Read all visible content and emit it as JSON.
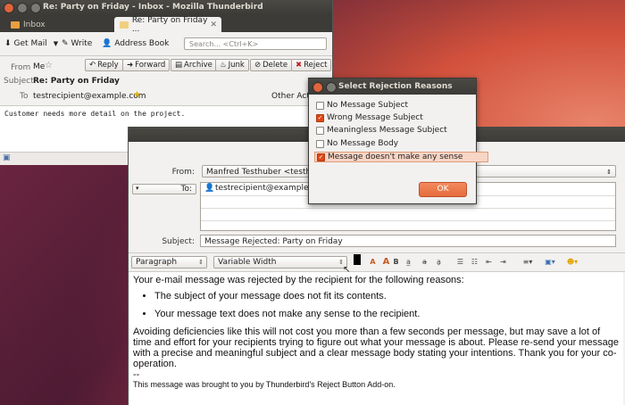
{
  "main_window": {
    "title": "Re: Party on Friday - Inbox - Mozilla Thunderbird",
    "tabs": [
      {
        "label": "Inbox"
      },
      {
        "label": "Re: Party on Friday ..."
      }
    ],
    "toolbar": {
      "get_mail": "Get Mail",
      "write": "Write",
      "address_book": "Address Book",
      "search_placeholder": "Search... <Ctrl+K>"
    },
    "header": {
      "from_label": "From",
      "from_value": "Me",
      "subject_label": "Subject",
      "subject_value": "Re: Party on Friday",
      "to_label": "To",
      "to_value": "testrecipient@example.com",
      "other_actions": "Other Acti",
      "actions": [
        "Reply",
        "Forward",
        "Archive",
        "Junk",
        "Delete",
        "Reject"
      ]
    },
    "body_text": "Customer needs more detail on the project."
  },
  "compose_window": {
    "from_label": "From:",
    "from_value": "Manfred Testhuber <testhub",
    "to_label": "To:",
    "to_value": "testrecipient@example.com",
    "subject_label": "Subject:",
    "subject_value": "Message Rejected: Party on Friday",
    "paragraph_select": "Paragraph",
    "font_select": "Variable Width",
    "body": {
      "intro": "Your e-mail message was rejected by the recipient for the following reasons:",
      "reasons": [
        "The subject of your message does not fit its contents.",
        "Your message text does not make any sense to the recipient."
      ],
      "closing": "Avoiding deficiencies like this will not cost you more than a few seconds per message, but may save a lot of time and effort for your recipients trying to figure out what your message is about. Please re-send your message with a precise and meaningful subject and a clear message body stating your intentions. Thank you for your co-operation.",
      "sig_sep": "--",
      "signature": "This message was brought to you by Thunderbird's Reject Button Add-on."
    }
  },
  "dialog": {
    "title": "Select Rejection Reasons",
    "options": [
      {
        "label": "No Message Subject",
        "checked": false
      },
      {
        "label": "Wrong Message Subject",
        "checked": true
      },
      {
        "label": "Meaningless Message Subject",
        "checked": false
      },
      {
        "label": "No Message Body",
        "checked": false
      },
      {
        "label": "Message doesn't make any sense",
        "checked": true
      }
    ],
    "ok_label": "OK"
  },
  "colors": {
    "accent": "#dd4814",
    "titlebar": "#3c3b37"
  }
}
